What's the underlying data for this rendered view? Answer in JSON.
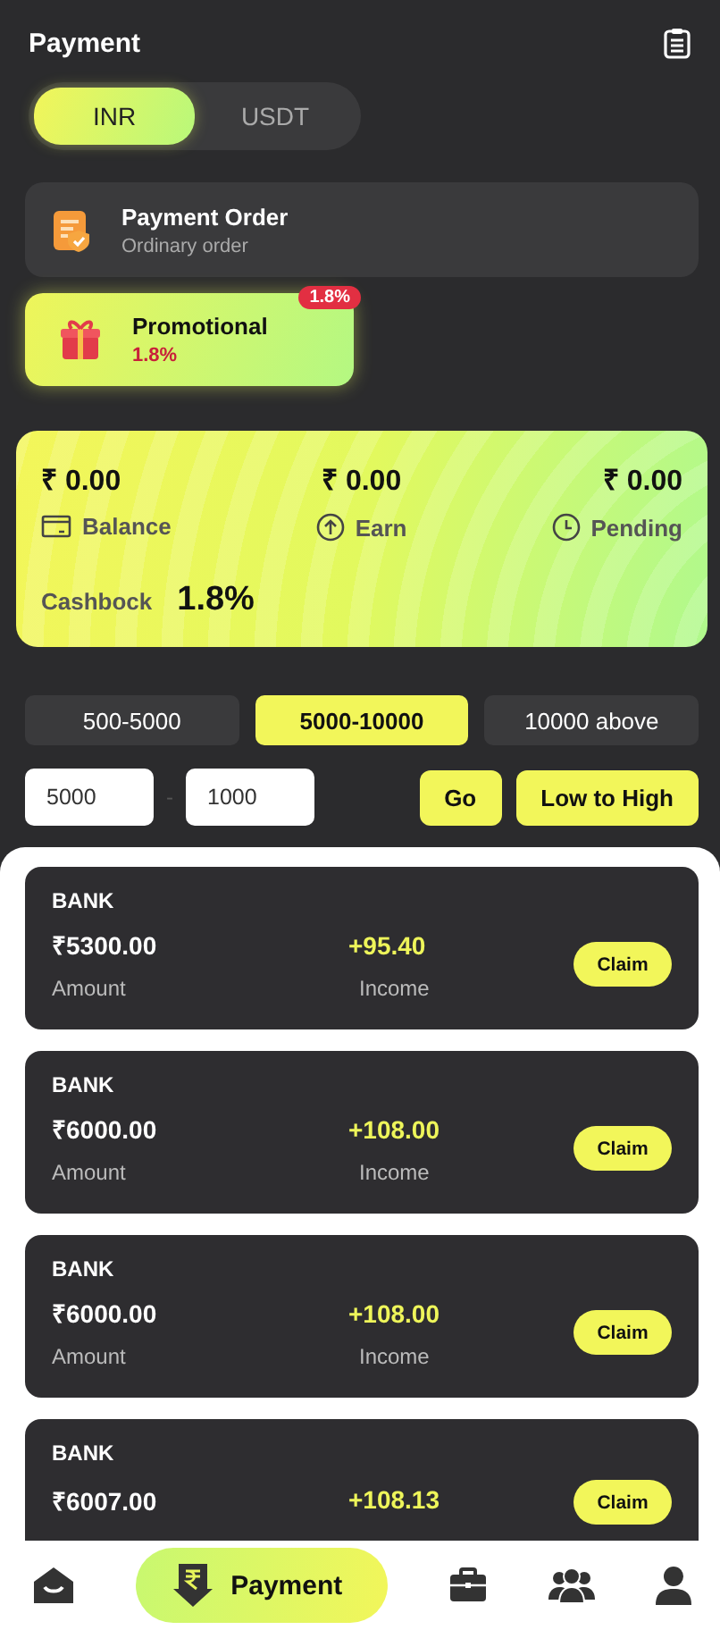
{
  "header": {
    "title": "Payment"
  },
  "currency_tabs": [
    {
      "label": "INR",
      "selected": true
    },
    {
      "label": "USDT",
      "selected": false
    }
  ],
  "order_types": [
    {
      "kind": "order",
      "title": "Payment Order",
      "subtitle": "Ordinary order",
      "selected": false
    },
    {
      "kind": "promo",
      "title": "Promotional",
      "subtitle": "1.8%",
      "badge": "1.8%",
      "selected": true
    }
  ],
  "summary": {
    "stats": [
      {
        "kind": "balance",
        "amount": "₹ 0.00",
        "label": "Balance"
      },
      {
        "kind": "earn",
        "amount": "₹ 0.00",
        "label": "Earn"
      },
      {
        "kind": "pending",
        "amount": "₹ 0.00",
        "label": "Pending"
      }
    ],
    "cashback_label": "Cashbock",
    "cashback_value": "1.8%"
  },
  "ranges": [
    {
      "label": "500-5000",
      "selected": false
    },
    {
      "label": "5000-10000",
      "selected": true
    },
    {
      "label": "10000 above",
      "selected": false
    }
  ],
  "filter": {
    "min": "5000",
    "separator": "-",
    "max": "1000",
    "go": "Go",
    "sort": "Low to High"
  },
  "orders": [
    {
      "method": "BANK",
      "amount": "₹5300.00",
      "amount_label": "Amount",
      "income": "+95.40",
      "income_label": "Income",
      "action": "Claim"
    },
    {
      "method": "BANK",
      "amount": "₹6000.00",
      "amount_label": "Amount",
      "income": "+108.00",
      "income_label": "Income",
      "action": "Claim"
    },
    {
      "method": "BANK",
      "amount": "₹6000.00",
      "amount_label": "Amount",
      "income": "+108.00",
      "income_label": "Income",
      "action": "Claim"
    },
    {
      "method": "BANK",
      "amount": "₹6007.00",
      "income": "+108.13",
      "action": "Claim"
    }
  ],
  "nav": [
    {
      "kind": "home",
      "selected": false
    },
    {
      "kind": "payment",
      "label": "Payment",
      "selected": true
    },
    {
      "kind": "briefcase",
      "selected": false
    },
    {
      "kind": "team",
      "selected": false
    },
    {
      "kind": "profile",
      "selected": false
    }
  ]
}
